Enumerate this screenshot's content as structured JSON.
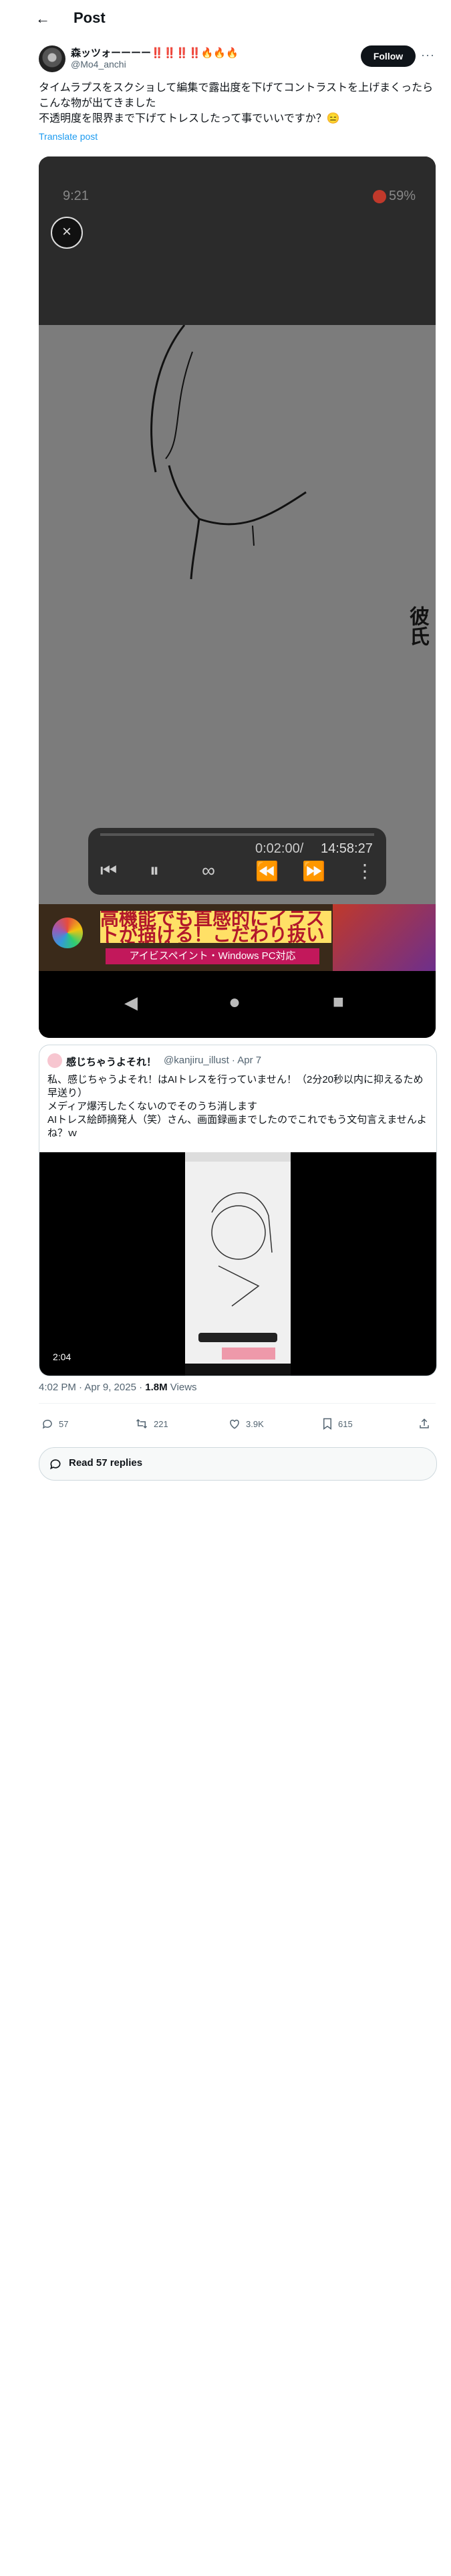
{
  "header": {
    "title": "Post"
  },
  "post": {
    "author_name": "森ッツォーーーー‼️‼️‼️‼️",
    "author_emoji": "🔥🔥🔥",
    "handle": "@Mo4_anchi",
    "follow_label": "Follow",
    "text_line1": "タイムラプスをスクショして編集で露出度を下げてコントラストを上げまくったらこんな物が出てきました",
    "text_line2": "不透明度を限界まで下げてトレスしたって事でいいですか？😑",
    "translate": "Translate post"
  },
  "video": {
    "status_time": "9:21",
    "status_battery": "59%",
    "side_text": "彼氏",
    "time_current": "0:02:00/",
    "time_total": "14:58:27",
    "ad_headline": "高機能でも直感的にイラストが描ける！こだわり抜いた操作性！",
    "ad_sub": "アイビスペイント・Windows PC対応"
  },
  "quote": {
    "name": "感じちゃうよそれ！",
    "handle": "@kanjiru_illust · Apr 7",
    "line1": "私、感じちゃうよそれ！はAIトレスを行っていません！（2分20秒以内に抑えるため早送り）",
    "line2": "メディア爆汚したくないのでそのうち消します",
    "line3": "AIトレス絵師摘発人（笑）さん、画面録画までしたのでこれでもう文句言えませんよね？ｗ",
    "duration": "2:04"
  },
  "meta": {
    "time": "4:02 PM · Apr 9, 2025 · ",
    "views": "1.8M",
    "views_label": " Views"
  },
  "actions": {
    "replies": "57",
    "reposts": "221",
    "likes": "3.9K",
    "bookmarks": "615"
  },
  "read_replies": "Read 57 replies"
}
